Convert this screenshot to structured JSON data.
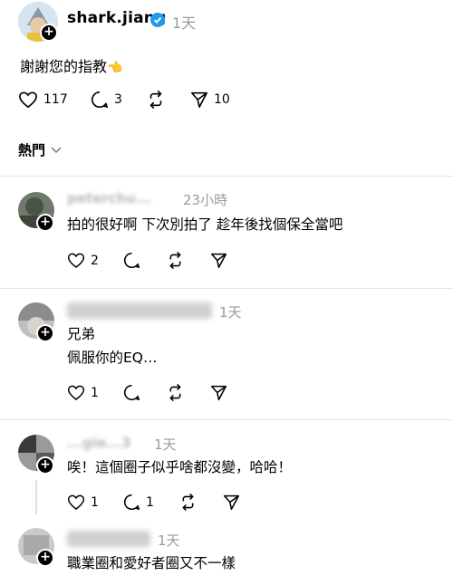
{
  "post": {
    "username": "shark.jiang",
    "time": "1天",
    "text": "謝謝您的指教",
    "emoji": "👈",
    "likes": "117",
    "replies": "3",
    "shares": "10"
  },
  "sort": {
    "label": "熱門"
  },
  "comments": [
    {
      "username": "peterchu...",
      "time": "23小時",
      "lines": [
        "拍的很好啊 下次別拍了 趁年後找個保全當吧"
      ],
      "likes": "2",
      "replies": ""
    },
    {
      "username": "...",
      "time": "1天",
      "lines": [
        "兄弟",
        "佩服你的EQ…"
      ],
      "likes": "1",
      "replies": ""
    },
    {
      "username": "...gie...3",
      "time": "1天",
      "lines": [
        "唉！這個圈子似乎啥都沒變，哈哈！"
      ],
      "likes": "1",
      "replies": "1"
    },
    {
      "username": "...",
      "time": "1天",
      "lines": [
        "職業圈和愛好者圈又不一樣"
      ],
      "likes": "",
      "replies": ""
    }
  ],
  "colors": {
    "verified": "#1d9bf0",
    "muted": "#9a9a9a"
  }
}
